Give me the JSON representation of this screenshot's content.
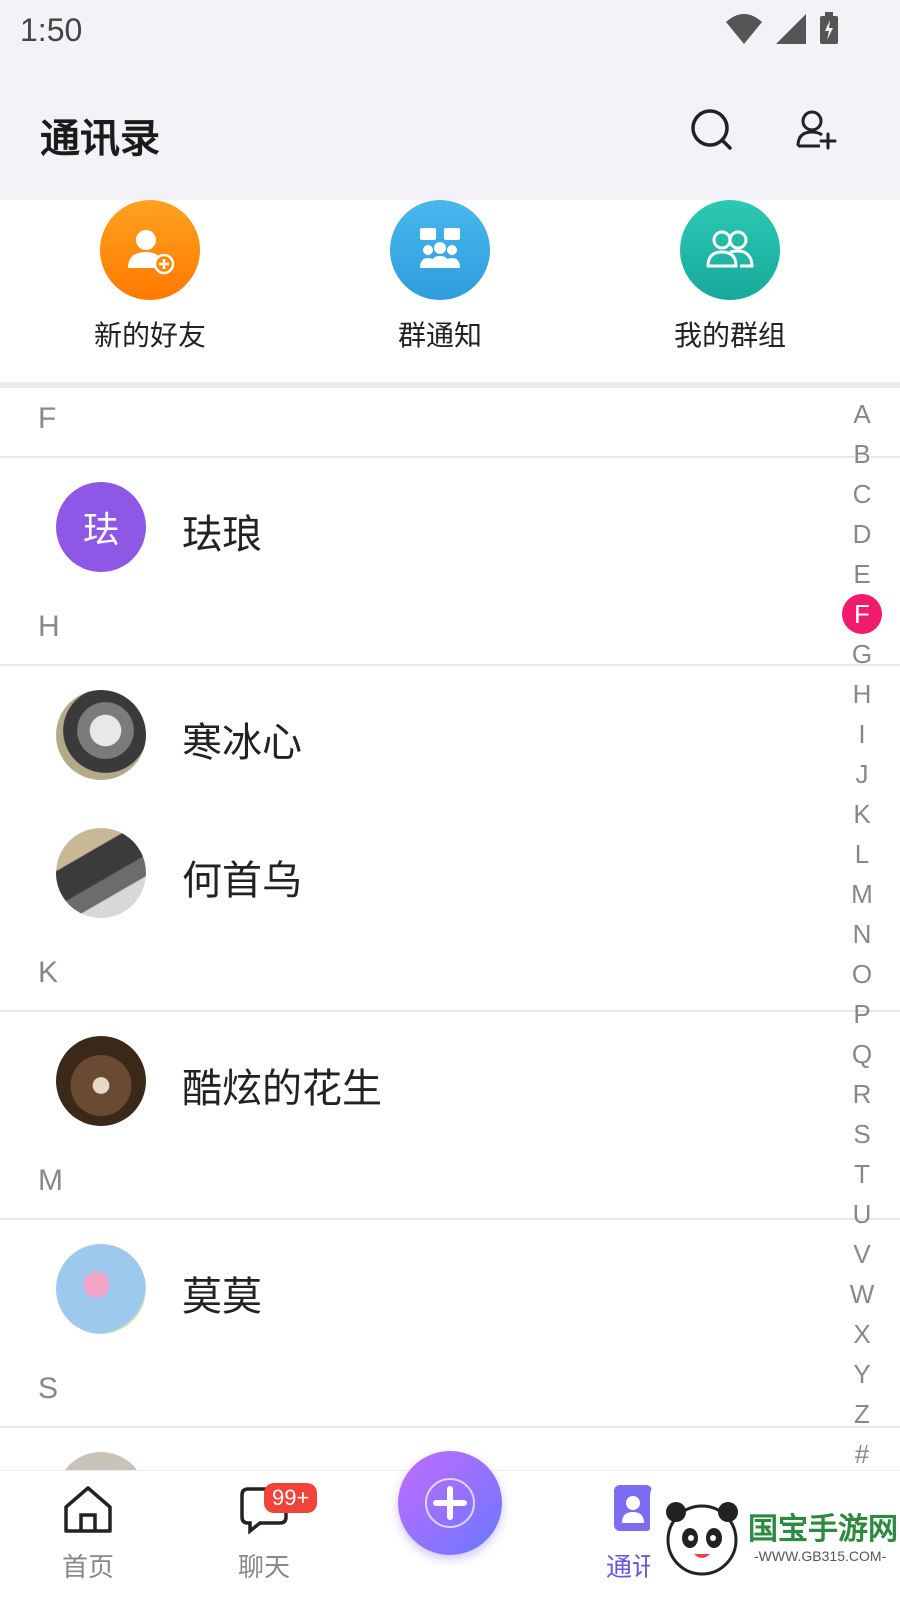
{
  "status": {
    "time": "1:50"
  },
  "header": {
    "title": "通讯录"
  },
  "shortcuts": [
    {
      "label": "新的好友",
      "color": "#ff8a00"
    },
    {
      "label": "群通知",
      "color": "#3aa9e6"
    },
    {
      "label": "我的群组",
      "color": "#1fb8a8"
    }
  ],
  "sections": [
    {
      "letter": "F",
      "contacts": [
        {
          "name": "珐琅",
          "avatar_text": "珐",
          "avatar_color": "#8f57e6"
        }
      ]
    },
    {
      "letter": "H",
      "contacts": [
        {
          "name": "寒冰心"
        },
        {
          "name": "何首乌"
        }
      ]
    },
    {
      "letter": "K",
      "contacts": [
        {
          "name": "酷炫的花生"
        }
      ]
    },
    {
      "letter": "M",
      "contacts": [
        {
          "name": "莫莫"
        }
      ]
    },
    {
      "letter": "S",
      "contacts": []
    }
  ],
  "alpha_index": [
    "A",
    "B",
    "C",
    "D",
    "E",
    "F",
    "G",
    "H",
    "I",
    "J",
    "K",
    "L",
    "M",
    "N",
    "O",
    "P",
    "Q",
    "R",
    "S",
    "T",
    "U",
    "V",
    "W",
    "X",
    "Y",
    "Z",
    "#"
  ],
  "alpha_active": "F",
  "tabs": [
    {
      "label": "首页"
    },
    {
      "label": "聊天",
      "badge": "99+"
    },
    {
      "label": ""
    },
    {
      "label": "通讯"
    },
    {
      "label": ""
    }
  ],
  "watermark": {
    "text": "国宝手游网",
    "url": "-WWW.GB315.COM-"
  },
  "colors": {
    "accent": "#6a55e0",
    "active_index": "#f01b6b",
    "badge": "#f0443a"
  }
}
